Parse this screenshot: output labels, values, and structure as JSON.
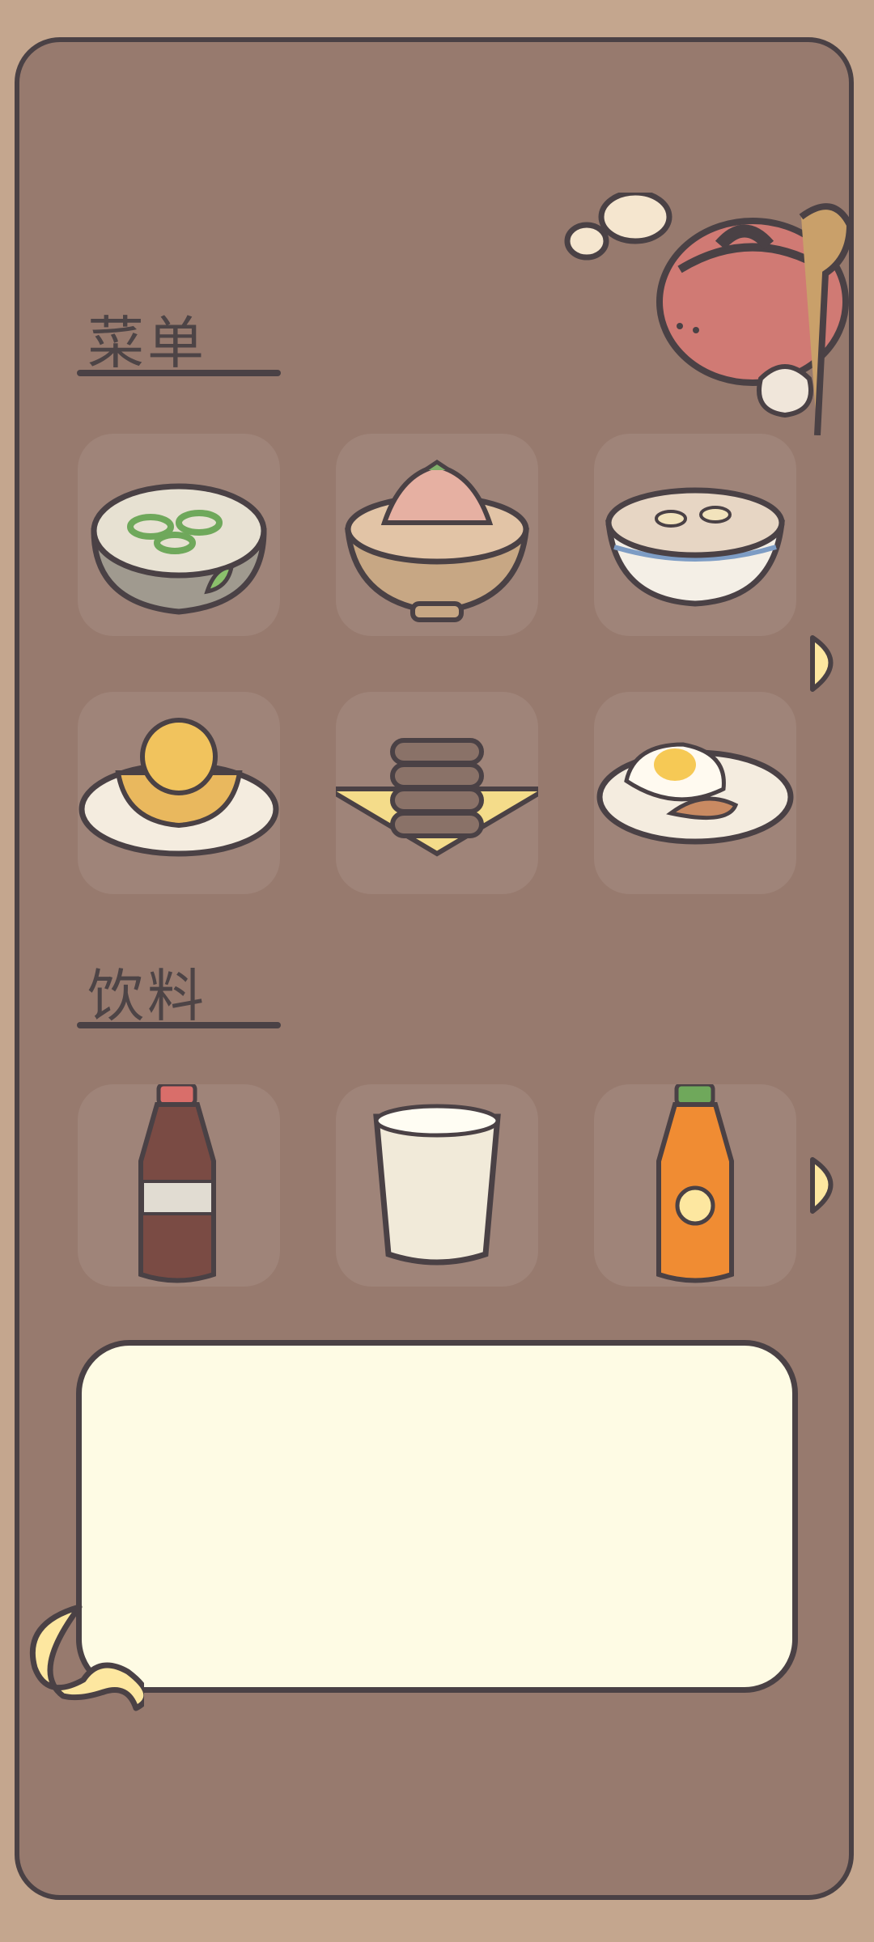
{
  "menu": {
    "title": "菜单",
    "items": [
      {
        "name": "noodle-soup-bowl"
      },
      {
        "name": "stew-bowl"
      },
      {
        "name": "soup-bowl"
      },
      {
        "name": "pie-plate"
      },
      {
        "name": "pancake-stack"
      },
      {
        "name": "fried-egg-plate"
      }
    ]
  },
  "drinks": {
    "title": "饮料",
    "items": [
      {
        "name": "cola-bottle"
      },
      {
        "name": "milk-glass"
      },
      {
        "name": "orange-soda-bottle"
      }
    ]
  },
  "note": {
    "text": ""
  },
  "colors": {
    "background": "#c4a68e",
    "panel": "#977a6e",
    "tile": "#9f8479",
    "outline": "#4a4145",
    "note": "#fefbe4",
    "accent_yellow": "#fde7a0"
  },
  "icons": [
    "cooking-pot-icon",
    "next-page-arrow-icon",
    "back-arrow-icon"
  ]
}
